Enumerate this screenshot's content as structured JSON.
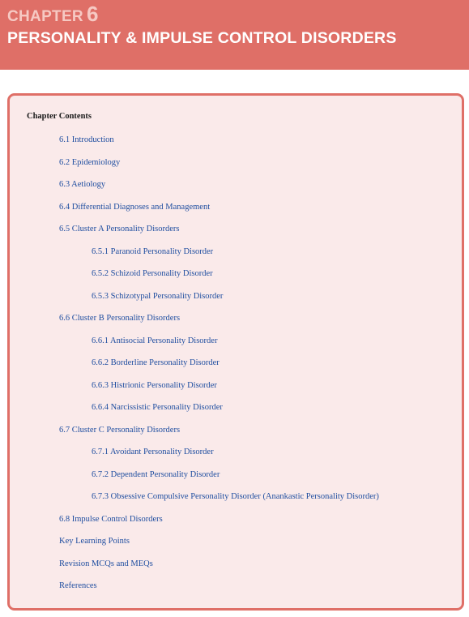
{
  "header": {
    "chapter_word": "CHAPTER",
    "chapter_number": "6",
    "title": "PERSONALITY & IMPULSE CONTROL DISORDERS"
  },
  "contents": {
    "heading": "Chapter Contents",
    "items": [
      {
        "label": "6.1 Introduction",
        "level": 1
      },
      {
        "label": "6.2 Epidemiology",
        "level": 1
      },
      {
        "label": "6.3 Aetiology",
        "level": 1
      },
      {
        "label": "6.4 Differential Diagnoses and Management",
        "level": 1
      },
      {
        "label": "6.5 Cluster A Personality Disorders",
        "level": 1
      },
      {
        "label": "6.5.1 Paranoid Personality Disorder",
        "level": 2
      },
      {
        "label": "6.5.2 Schizoid Personality Disorder",
        "level": 2
      },
      {
        "label": "6.5.3 Schizotypal Personality Disorder",
        "level": 2
      },
      {
        "label": "6.6 Cluster B Personality Disorders",
        "level": 1
      },
      {
        "label": "6.6.1 Antisocial Personality Disorder",
        "level": 2
      },
      {
        "label": "6.6.2 Borderline Personality Disorder",
        "level": 2
      },
      {
        "label": "6.6.3 Histrionic Personality Disorder",
        "level": 2
      },
      {
        "label": "6.6.4 Narcissistic Personality Disorder",
        "level": 2
      },
      {
        "label": "6.7 Cluster C Personality Disorders",
        "level": 1
      },
      {
        "label": "6.7.1 Avoidant Personality Disorder",
        "level": 2
      },
      {
        "label": "6.7.2 Dependent Personality Disorder",
        "level": 2
      },
      {
        "label": "6.7.3 Obsessive Compulsive Personality Disorder (Anankastic Personality Disorder)",
        "level": 2
      },
      {
        "label": "6.8 Impulse Control Disorders",
        "level": 1
      },
      {
        "label": "Key Learning Points",
        "level": 1
      },
      {
        "label": "Revision MCQs and MEQs",
        "level": 1
      },
      {
        "label": "References",
        "level": 1
      }
    ]
  },
  "colors": {
    "header_background": "#df6f67",
    "chapter_label": "#f6c9c3",
    "box_border": "#df6f67",
    "box_background": "#faeaea",
    "link": "#1f4ea0"
  }
}
